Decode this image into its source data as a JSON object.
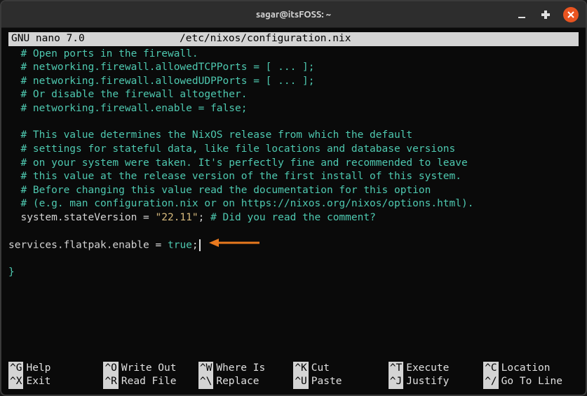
{
  "titlebar": {
    "title": "sagar@itsFOSS: ~"
  },
  "nano": {
    "app": "  GNU nano 7.0",
    "file": "/etc/nixos/configuration.nix"
  },
  "lines": {
    "l1": "  # Open ports in the firewall.",
    "l2": "  # networking.firewall.allowedTCPPorts = [ ... ];",
    "l3": "  # networking.firewall.allowedUDPPorts = [ ... ];",
    "l4": "  # Or disable the firewall altogether.",
    "l5": "  # networking.firewall.enable = false;",
    "l6": "",
    "l7": "  # This value determines the NixOS release from which the default",
    "l8": "  # settings for stateful data, like file locations and database versions",
    "l9": "  # on your system were taken. It's perfectly fine and recommended to leave",
    "l10": "  # this value at the release version of the first install of this system.",
    "l11": "  # Before changing this value read the documentation for this option",
    "l12": "  # (e.g. man configuration.nix or on https://nixos.org/nixos/options.html).",
    "l13a": "  system.stateVersion = ",
    "l13b": "\"22.11\"",
    "l13c": "; ",
    "l13d": "# Did you read the comment?",
    "l14": "",
    "l15a": "services.flatpak.enable = ",
    "l15b": "true",
    "l15c": ";",
    "l16": "",
    "l17": "}"
  },
  "shortcuts": {
    "help_k": "^G",
    "help_l": "Help",
    "writeout_k": "^O",
    "writeout_l": "Write Out",
    "whereis_k": "^W",
    "whereis_l": "Where Is",
    "cut_k": "^K",
    "cut_l": "Cut",
    "execute_k": "^T",
    "execute_l": "Execute",
    "location_k": "^C",
    "location_l": "Location",
    "exit_k": "^X",
    "exit_l": "Exit",
    "readfile_k": "^R",
    "readfile_l": "Read File",
    "replace_k": "^\\",
    "replace_l": "Replace",
    "paste_k": "^U",
    "paste_l": "Paste",
    "justify_k": "^J",
    "justify_l": "Justify",
    "gotoline_k": "^/",
    "gotoline_l": "Go To Line"
  },
  "colors": {
    "comment": "#4ec9b0",
    "string": "#d7ba7d",
    "arrow": "#e8791e"
  }
}
